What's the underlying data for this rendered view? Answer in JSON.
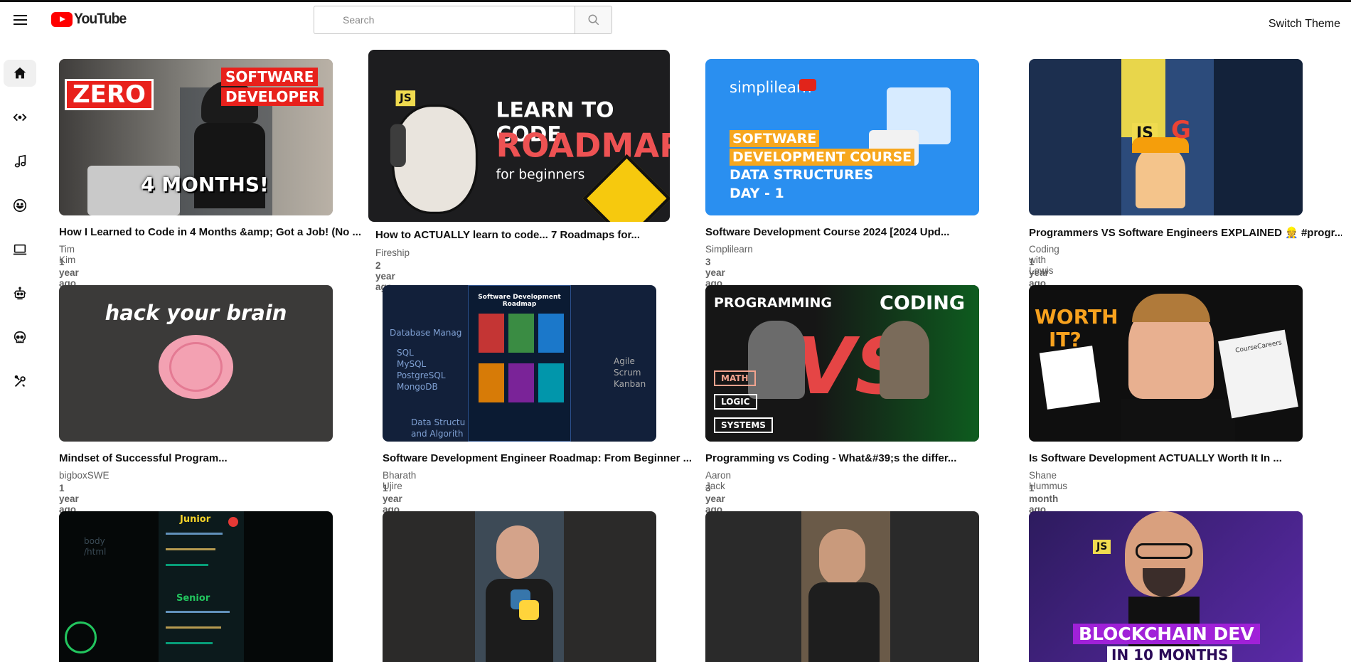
{
  "header": {
    "logo_text": "YouTube",
    "search_placeholder": "Search",
    "switch_theme": "Switch Theme"
  },
  "sidebar": {
    "items": [
      {
        "icon": "home-icon",
        "active": true
      },
      {
        "icon": "code-icon",
        "active": false
      },
      {
        "icon": "music-icon",
        "active": false
      },
      {
        "icon": "smile-icon",
        "active": false
      },
      {
        "icon": "laptop-icon",
        "active": false
      },
      {
        "icon": "robot-icon",
        "active": false
      },
      {
        "icon": "skull-icon",
        "active": false
      },
      {
        "icon": "tools-icon",
        "active": false
      }
    ]
  },
  "videos": [
    {
      "title": "How I Learned to Code in 4 Months &amp; Got a Job! (No ...",
      "channel": "Tim Kim",
      "ago": "1 year ago",
      "thumb": {
        "bg": "#7a6f66",
        "texts": [
          "ZERO",
          "SOFTWARE",
          "DEVELOPER",
          "4 MONTHS!"
        ]
      }
    },
    {
      "title": "How to ACTUALLY learn to code... 7 Roadmaps for...",
      "channel": "Fireship",
      "ago": "2 year ago",
      "thumb": {
        "bg": "#1d1d1f",
        "texts": [
          "LEARN TO CODE",
          "ROADMAP",
          "for beginners",
          "JS"
        ]
      }
    },
    {
      "title": "Software Development Course 2024 [2024 Upd...",
      "channel": "Simplilearn",
      "ago": "3 year ago",
      "thumb": {
        "bg": "#2a8ff0",
        "texts": [
          "simplilearn",
          "SOFTWARE",
          "DEVELOPMENT COURSE",
          "DATA STRUCTURES",
          "DAY - 1"
        ]
      }
    },
    {
      "title": "Programmers VS Software Engineers EXPLAINED 👷 #progr...",
      "channel": "Coding with Lewis",
      "ago": "1 year ago",
      "thumb": {
        "bg": "#1c2f4f",
        "texts": [
          "JS"
        ]
      }
    },
    {
      "title": "Mindset of Successful Program...",
      "channel": "bigboxSWE",
      "ago": "1 year ago",
      "thumb": {
        "bg": "#3b3a39",
        "texts": [
          "hack your brain"
        ]
      }
    },
    {
      "title": "Software Development Engineer Roadmap: From Beginner ...",
      "channel": "Bharath Ujire",
      "ago": "1 year ago",
      "thumb": {
        "bg": "#12203a",
        "texts": [
          "Software Development Roadmap",
          "Database Manag",
          "SQL",
          "MySQL",
          "PostgreSQL",
          "MongoDB",
          "Data Structu",
          "and Algorith",
          "Agile",
          "Scrum",
          "Kanban"
        ]
      }
    },
    {
      "title": "Programming vs Coding - What&#39;s the differ...",
      "channel": "Aaron Jack",
      "ago": "3 year ago",
      "thumb": {
        "bg": "#1b1b1b",
        "texts": [
          "PROGRAMMING",
          "CODING",
          "VS",
          "MATH",
          "LOGIC",
          "SYSTEMS"
        ]
      }
    },
    {
      "title": "Is Software Development ACTUALLY Worth It In ...",
      "channel": "Shane Hummus",
      "ago": "1 month ago",
      "thumb": {
        "bg": "#0f0f0f",
        "texts": [
          "WORTH",
          "IT?",
          "CourseCareers"
        ]
      }
    },
    {
      "title": "",
      "channel": "",
      "ago": "",
      "thumb": {
        "bg": "#050808",
        "texts": [
          "Junior",
          "Senior",
          "body",
          "/html"
        ]
      }
    },
    {
      "title": "",
      "channel": "",
      "ago": "",
      "thumb": {
        "bg": "#2b2a29",
        "texts": []
      }
    },
    {
      "title": "",
      "channel": "",
      "ago": "",
      "thumb": {
        "bg": "#2a2a2a",
        "texts": []
      }
    },
    {
      "title": "",
      "channel": "",
      "ago": "",
      "thumb": {
        "bg": "#2d1b5e",
        "texts": [
          "BLOCKCHAIN DEV",
          "IN 10 MONTHS",
          "JS"
        ]
      }
    }
  ],
  "colors": {
    "accent_red": "#ff0000",
    "text_primary": "#0f0f0f",
    "text_secondary": "#606060"
  }
}
